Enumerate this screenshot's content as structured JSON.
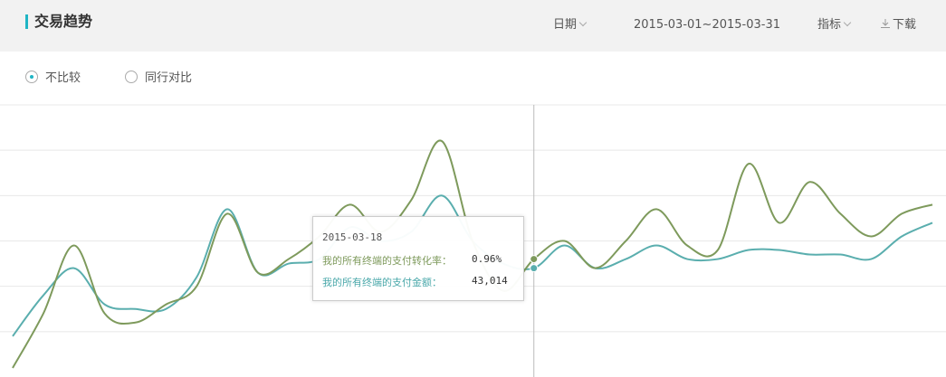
{
  "header": {
    "title": "交易趋势",
    "date_label": "日期",
    "date_range": "2015-03-01~2015-03-31",
    "metric_label": "指标",
    "download_label": "下载"
  },
  "compare": {
    "options": [
      {
        "label": "不比较",
        "checked": true
      },
      {
        "label": "同行对比",
        "checked": false
      }
    ]
  },
  "tooltip": {
    "date": "2015-03-18",
    "rows": [
      {
        "label": "我的所有终端的支付转化率：",
        "value": "0.96%"
      },
      {
        "label": "我的所有终端的支付金额：",
        "value": "43,014"
      }
    ]
  },
  "colors": {
    "accent": "#1fb5c4",
    "series_conversion": "#7e9a5c",
    "series_amount": "#5aaeae"
  },
  "chart_data": {
    "type": "line",
    "x": [
      1,
      2,
      3,
      4,
      5,
      6,
      7,
      8,
      9,
      10,
      11,
      12,
      13,
      14,
      15,
      16,
      17,
      18,
      19,
      20,
      21,
      22,
      23,
      24,
      25,
      26,
      27,
      28,
      29,
      30,
      31
    ],
    "x_dates_start": "2015-03-01",
    "ylim": [
      0,
      6
    ],
    "grid": true,
    "crosshair_x": 18,
    "series": [
      {
        "name": "我的所有终端的支付转化率",
        "color": "#7e9a5c",
        "values": [
          0.2,
          1.4,
          2.9,
          1.4,
          1.2,
          1.6,
          2.0,
          3.6,
          2.3,
          2.6,
          3.1,
          3.8,
          3.2,
          3.9,
          5.2,
          3.0,
          1.9,
          2.6,
          3.0,
          2.4,
          3.0,
          3.7,
          2.9,
          2.8,
          4.7,
          3.4,
          4.3,
          3.6,
          3.1,
          3.6,
          3.8
        ]
      },
      {
        "name": "我的所有终端的支付金额",
        "color": "#5aaeae",
        "values": [
          0.9,
          1.8,
          2.4,
          1.6,
          1.5,
          1.5,
          2.2,
          3.7,
          2.3,
          2.5,
          2.6,
          3.3,
          3.0,
          3.2,
          4.0,
          3.0,
          2.5,
          2.4,
          2.9,
          2.4,
          2.6,
          2.9,
          2.6,
          2.6,
          2.8,
          2.8,
          2.7,
          2.7,
          2.6,
          3.1,
          3.4
        ]
      }
    ]
  }
}
